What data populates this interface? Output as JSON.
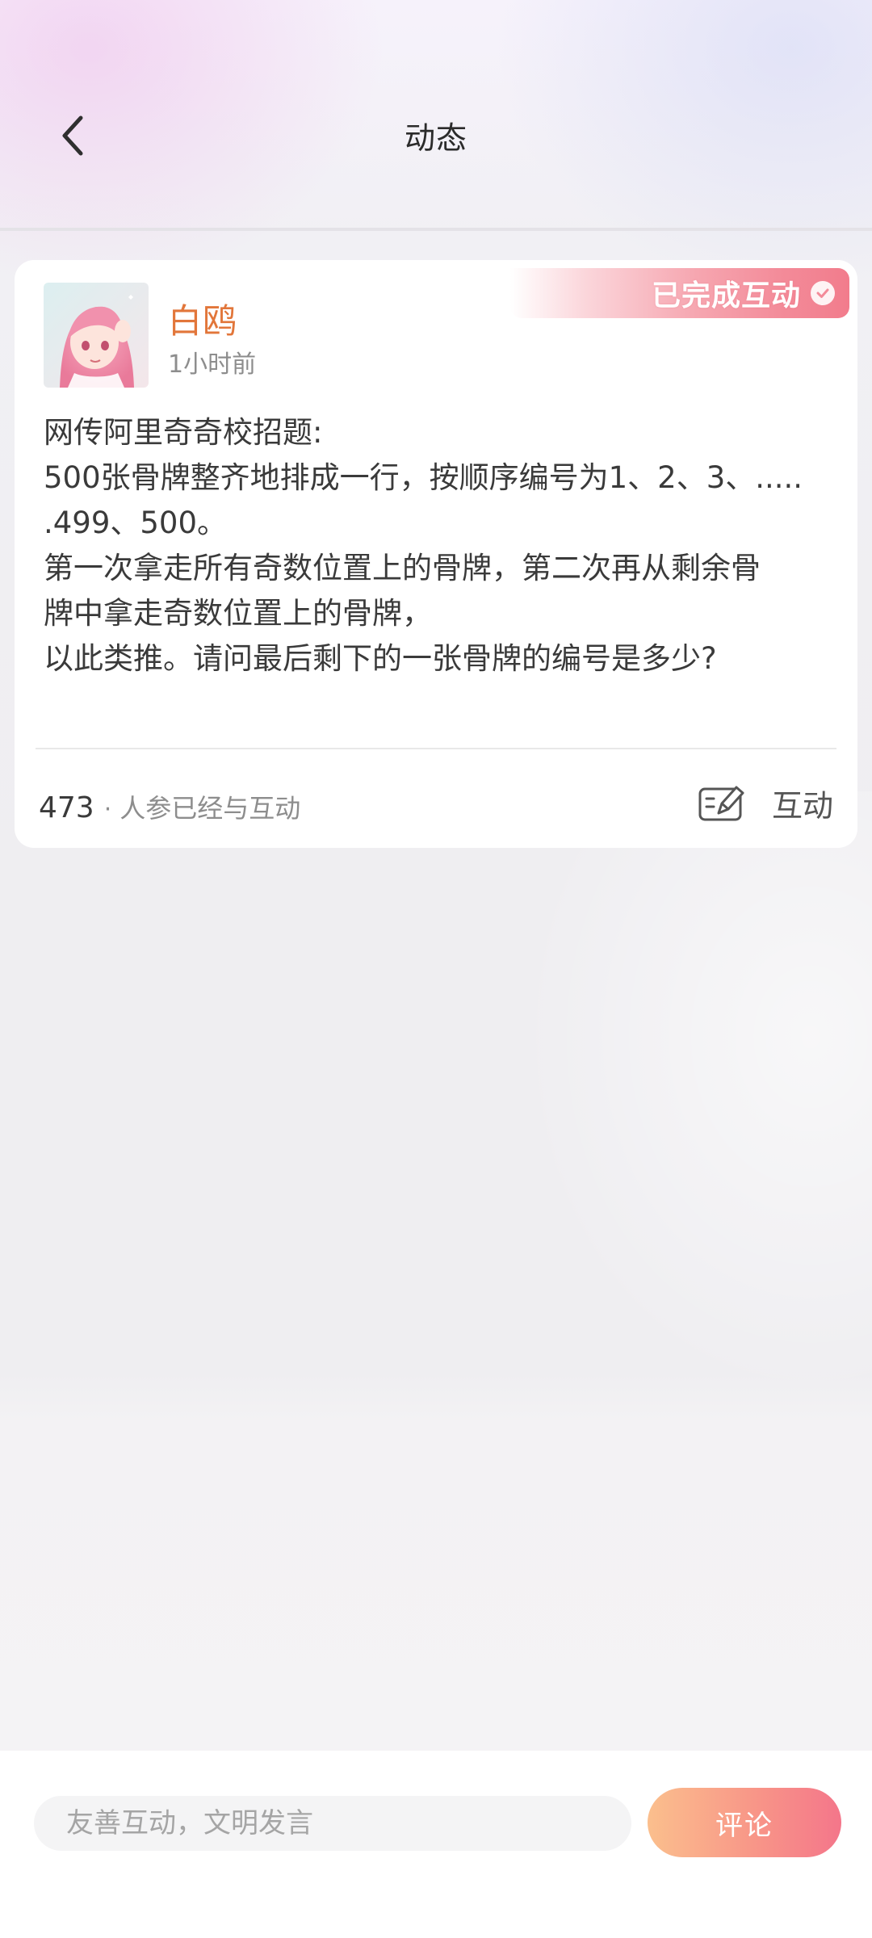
{
  "header": {
    "title": "动态",
    "back_icon": "chevron-left-icon"
  },
  "post": {
    "badge": "已完成互动",
    "badge_icon": "check-circle-icon",
    "author": {
      "name": "白鸥",
      "time": "1小时前",
      "avatar": "anime-girl-pink-hair-avatar"
    },
    "body_lines": [
      "网传阿里奇奇校招题:",
      "500张骨牌整齐地排成一行，按顺序编号为1、2、3、.....",
      ".499、500。",
      "第一次拿走所有奇数位置上的骨牌，第二次再从剩余骨",
      "牌中拿走奇数位置上的骨牌，",
      "以此类推。请问最后剩下的一张骨牌的编号是多少?"
    ],
    "participants": {
      "count": "473",
      "separator": "·",
      "label": "人参已经与互动"
    },
    "interact": {
      "label": "互动",
      "icon": "edit-note-icon"
    }
  },
  "bottom_bar": {
    "input_placeholder": "友善互动，文明发言",
    "input_value": "",
    "submit_label": "评论"
  },
  "colors": {
    "author_name": "#e2763a",
    "badge_gradient_end": "#f27c8c",
    "comment_button_start": "#fbbf8d",
    "comment_button_end": "#f4768a"
  }
}
